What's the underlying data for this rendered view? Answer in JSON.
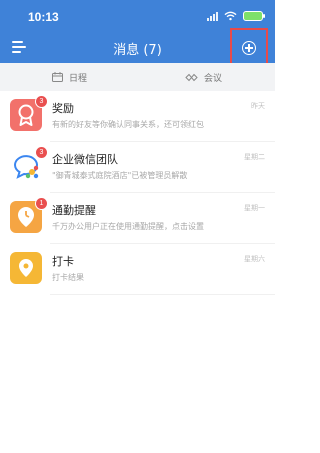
{
  "status_bar": {
    "time": "10:13"
  },
  "header": {
    "title": "消息 (7)"
  },
  "tabs": [
    {
      "label": "日程",
      "icon": "calendar-icon"
    },
    {
      "label": "会议",
      "icon": "meeting-icon"
    }
  ],
  "messages": [
    {
      "name": "奖励",
      "preview": "有新的好友等你确认同事关系，还可领红包",
      "time": "昨天",
      "badge": "3",
      "icon": "award-icon",
      "color": "#f2716b"
    },
    {
      "name": "企业微信团队",
      "preview": "\"御青城泰式庭院酒店\"已被管理员解散",
      "time": "星期二",
      "badge": "3",
      "icon": "wecom-logo-icon",
      "color": "#ffffff"
    },
    {
      "name": "通勤提醒",
      "preview": "千万办公用户正在使用通勤提醒，点击设置",
      "time": "星期一",
      "badge": "1",
      "icon": "commute-clock-icon",
      "color": "#f5a543"
    },
    {
      "name": "打卡",
      "preview": "打卡结果",
      "time": "星期六",
      "badge": "",
      "icon": "location-pin-icon",
      "color": "#f5b735"
    }
  ],
  "colors": {
    "header": "#3f82d8",
    "badge": "#e94f4f",
    "highlight": "#e84a4a"
  }
}
